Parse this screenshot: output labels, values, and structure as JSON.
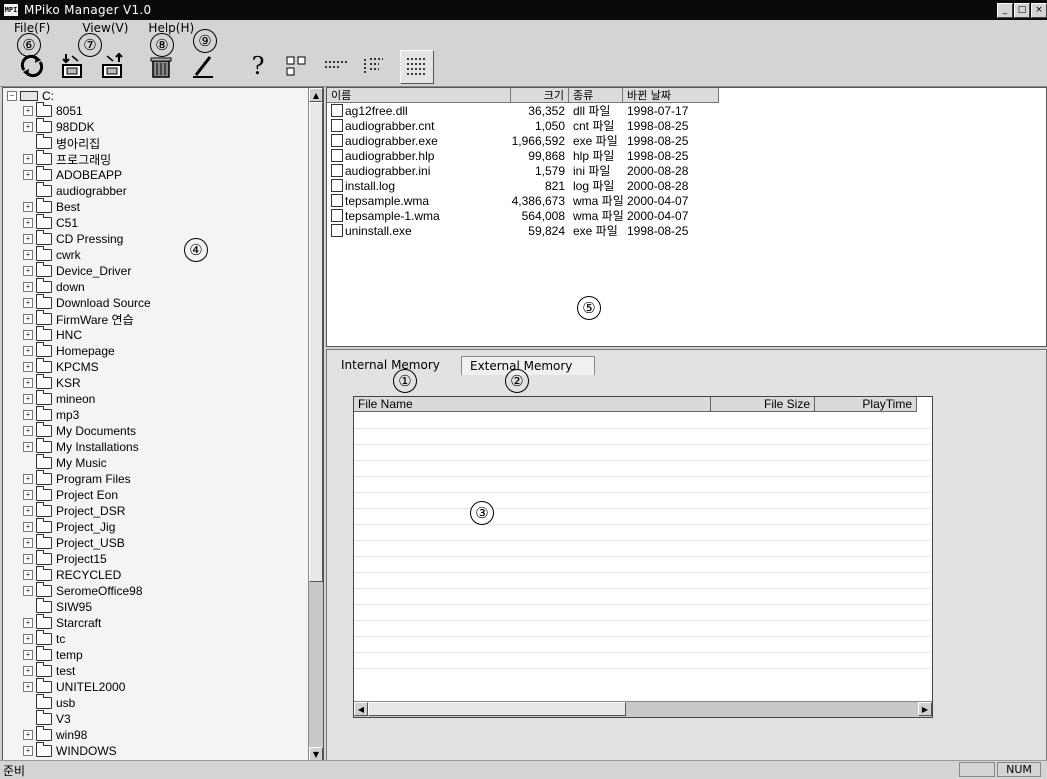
{
  "window": {
    "title": "MPiko Manager V1.0",
    "icon_label": "MPI",
    "controls": [
      "_",
      "□",
      "×"
    ]
  },
  "menu": [
    "File(F)",
    "View(V)",
    "Help(H)"
  ],
  "markers": {
    "internal_tab": "①",
    "external_tab": "②",
    "grid": "③",
    "tree": "④",
    "file_list": "⑤",
    "refresh": "⑥",
    "transfer": "⑦",
    "delete": "⑧",
    "edit": "⑨"
  },
  "toolbar": {
    "help_glyph": "?",
    "list_glyph": "∷"
  },
  "tree": {
    "root": "C:",
    "items": [
      {
        "label": "8051",
        "exp": true
      },
      {
        "label": "98DDK",
        "exp": true
      },
      {
        "label": "병아리집",
        "exp": false
      },
      {
        "label": "프로그래밍",
        "exp": true
      },
      {
        "label": "ADOBEAPP",
        "exp": true
      },
      {
        "label": "audiograbber",
        "exp": false
      },
      {
        "label": "Best",
        "exp": true
      },
      {
        "label": "C51",
        "exp": true
      },
      {
        "label": "CD Pressing",
        "exp": true
      },
      {
        "label": "cwrk",
        "exp": true
      },
      {
        "label": "Device_Driver",
        "exp": true
      },
      {
        "label": "down",
        "exp": true
      },
      {
        "label": "Download Source",
        "exp": true
      },
      {
        "label": "FirmWare 연습",
        "exp": true
      },
      {
        "label": "HNC",
        "exp": true
      },
      {
        "label": "Homepage",
        "exp": true
      },
      {
        "label": "KPCMS",
        "exp": true
      },
      {
        "label": "KSR",
        "exp": true
      },
      {
        "label": "mineon",
        "exp": true
      },
      {
        "label": "mp3",
        "exp": true
      },
      {
        "label": "My Documents",
        "exp": true
      },
      {
        "label": "My Installations",
        "exp": true
      },
      {
        "label": "My Music",
        "exp": false
      },
      {
        "label": "Program Files",
        "exp": true
      },
      {
        "label": "Project Eon",
        "exp": true
      },
      {
        "label": "Project_DSR",
        "exp": true
      },
      {
        "label": "Project_Jig",
        "exp": true
      },
      {
        "label": "Project_USB",
        "exp": true
      },
      {
        "label": "Project15",
        "exp": true
      },
      {
        "label": "RECYCLED",
        "exp": true
      },
      {
        "label": "SeromeOffice98",
        "exp": true
      },
      {
        "label": "SIW95",
        "exp": false
      },
      {
        "label": "Starcraft",
        "exp": true
      },
      {
        "label": "tc",
        "exp": true
      },
      {
        "label": "temp",
        "exp": true
      },
      {
        "label": "test",
        "exp": true
      },
      {
        "label": "UNITEL2000",
        "exp": true
      },
      {
        "label": "usb",
        "exp": false
      },
      {
        "label": "V3",
        "exp": false
      },
      {
        "label": "win98",
        "exp": true
      },
      {
        "label": "WINDOWS",
        "exp": true
      }
    ]
  },
  "file_list": {
    "columns": [
      "이름",
      "크기",
      "종류",
      "바뀐 날짜"
    ],
    "rows": [
      {
        "name": "ag12free.dll",
        "size": "36,352",
        "type": "dll 파일",
        "date": "1998-07-17"
      },
      {
        "name": "audiograbber.cnt",
        "size": "1,050",
        "type": "cnt 파일",
        "date": "1998-08-25"
      },
      {
        "name": "audiograbber.exe",
        "size": "1,966,592",
        "type": "exe 파일",
        "date": "1998-08-25"
      },
      {
        "name": "audiograbber.hlp",
        "size": "99,868",
        "type": "hlp 파일",
        "date": "1998-08-25"
      },
      {
        "name": "audiograbber.ini",
        "size": "1,579",
        "type": "ini 파일",
        "date": "2000-08-28"
      },
      {
        "name": "install.log",
        "size": "821",
        "type": "log 파일",
        "date": "2000-08-28"
      },
      {
        "name": "tepsample.wma",
        "size": "4,386,673",
        "type": "wma 파일",
        "date": "2000-04-07"
      },
      {
        "name": "tepsample-1.wma",
        "size": "564,008",
        "type": "wma 파일",
        "date": "2000-04-07"
      },
      {
        "name": "uninstall.exe",
        "size": "59,824",
        "type": "exe 파일",
        "date": "1998-08-25"
      }
    ]
  },
  "tabs": [
    "Internal Memory",
    "External Memory"
  ],
  "grid": {
    "columns": [
      "File Name",
      "File Size",
      "PlayTime"
    ]
  },
  "status": {
    "text": "준비",
    "num": "NUM"
  }
}
